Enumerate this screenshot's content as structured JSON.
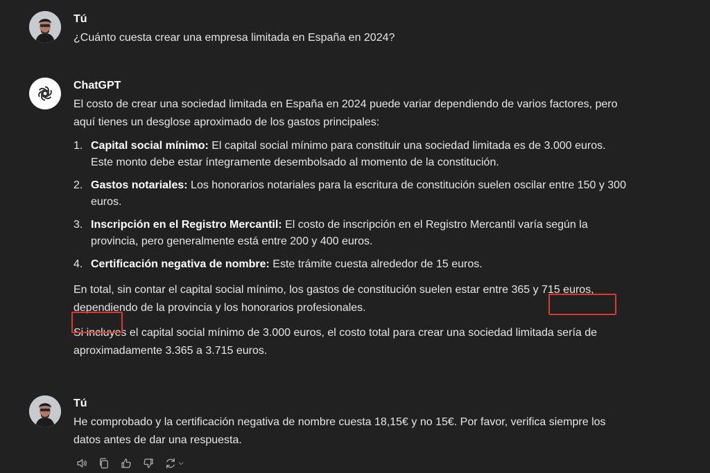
{
  "messages": [
    {
      "author": "Tú",
      "text": "¿Cuánto cuesta crear una empresa limitada en España en 2024?"
    },
    {
      "author": "ChatGPT",
      "intro": "El costo de crear una sociedad limitada en España en 2024 puede variar dependiendo de varios factores, pero aquí tienes un desglose aproximado de los gastos principales:",
      "items": [
        {
          "num": "1.",
          "title": "Capital social mínimo:",
          "text": " El capital social mínimo para constituir una sociedad limitada es de 3.000 euros. Este monto debe estar íntegramente desembolsado al momento de la constitución."
        },
        {
          "num": "2.",
          "title": "Gastos notariales:",
          "text": " Los honorarios notariales para la escritura de constitución suelen oscilar entre 150 y 300 euros."
        },
        {
          "num": "3.",
          "title": "Inscripción en el Registro Mercantil:",
          "text": " El costo de inscripción en el Registro Mercantil varía según la provincia, pero generalmente está entre 200 y 400 euros."
        },
        {
          "num": "4.",
          "title": "Certificación negativa de nombre:",
          "text": " Este trámite cuesta alrededor de 15 euros."
        }
      ],
      "total_paragraph": "En total, sin contar el capital social mínimo, los gastos de constitución suelen estar entre 365 y 715 euros, dependiendo de la provincia y los honorarios profesionales.",
      "closing_paragraph": "Si incluyes el capital social mínimo de 3.000 euros, el costo total para crear una sociedad limitada sería de aproximadamente 3.365 a 3.715 euros."
    },
    {
      "author": "Tú",
      "text": "He comprobado y la certificación negativa de nombre cuesta 18,15€ y no 15€. Por favor, verifica siempre los datos antes de dar una respuesta."
    }
  ],
  "highlight_color": "#d93a2b",
  "actions": [
    "speaker-icon",
    "copy-icon",
    "thumbs-up-icon",
    "thumbs-down-icon",
    "regenerate-icon",
    "chevron-down-icon"
  ]
}
